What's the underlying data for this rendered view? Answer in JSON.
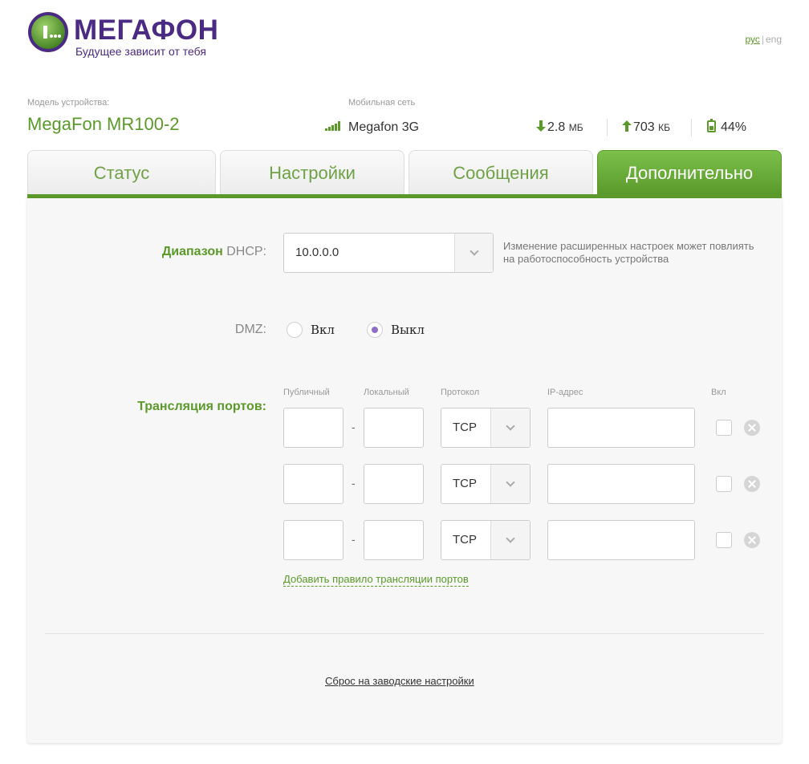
{
  "header": {
    "logo_name": "МЕГАФОН",
    "slogan": "Будущее зависит от тебя",
    "lang_ru": "рус",
    "lang_sep": "|",
    "lang_en": "eng"
  },
  "device": {
    "model_label": "Модель устройства:",
    "model_name": "MegaFon MR100-2",
    "network_label": "Мобильная сеть",
    "network_name": "Megafon 3G",
    "download": "2.8",
    "download_unit": "МБ",
    "upload": "703",
    "upload_unit": "КБ",
    "battery": "44%"
  },
  "tabs": [
    {
      "label": "Статус",
      "active": false
    },
    {
      "label": "Настройки",
      "active": false
    },
    {
      "label": "Сообщения",
      "active": false
    },
    {
      "label": "Дополнительно",
      "active": true
    }
  ],
  "dhcp": {
    "label_bold": "Диапазон",
    "label_rest": "DHCP:",
    "value": "10.0.0.0",
    "hint": "Изменение расширенных настроек может повлиять на работоспособность устройства"
  },
  "dmz": {
    "label": "DMZ:",
    "on_label": "Вкл",
    "off_label": "Выкл",
    "selected": "off"
  },
  "port_forwarding": {
    "label": "Трансляция портов:",
    "columns": {
      "public": "Публичный",
      "local": "Локальный",
      "protocol": "Протокол",
      "ip": "IP-адрес",
      "enabled": "Вкл"
    },
    "separator": "-",
    "rows": [
      {
        "protocol": "TCP",
        "enabled": false
      },
      {
        "protocol": "TCP",
        "enabled": false
      },
      {
        "protocol": "TCP",
        "enabled": false
      }
    ],
    "add_rule": "Добавить правило трансляции портов"
  },
  "reset_link": "Сброс на заводские настройки",
  "colors": {
    "brand_purple": "#4b2a84",
    "brand_green": "#5b9a2a",
    "radio_selected": "#8e6cc7"
  }
}
